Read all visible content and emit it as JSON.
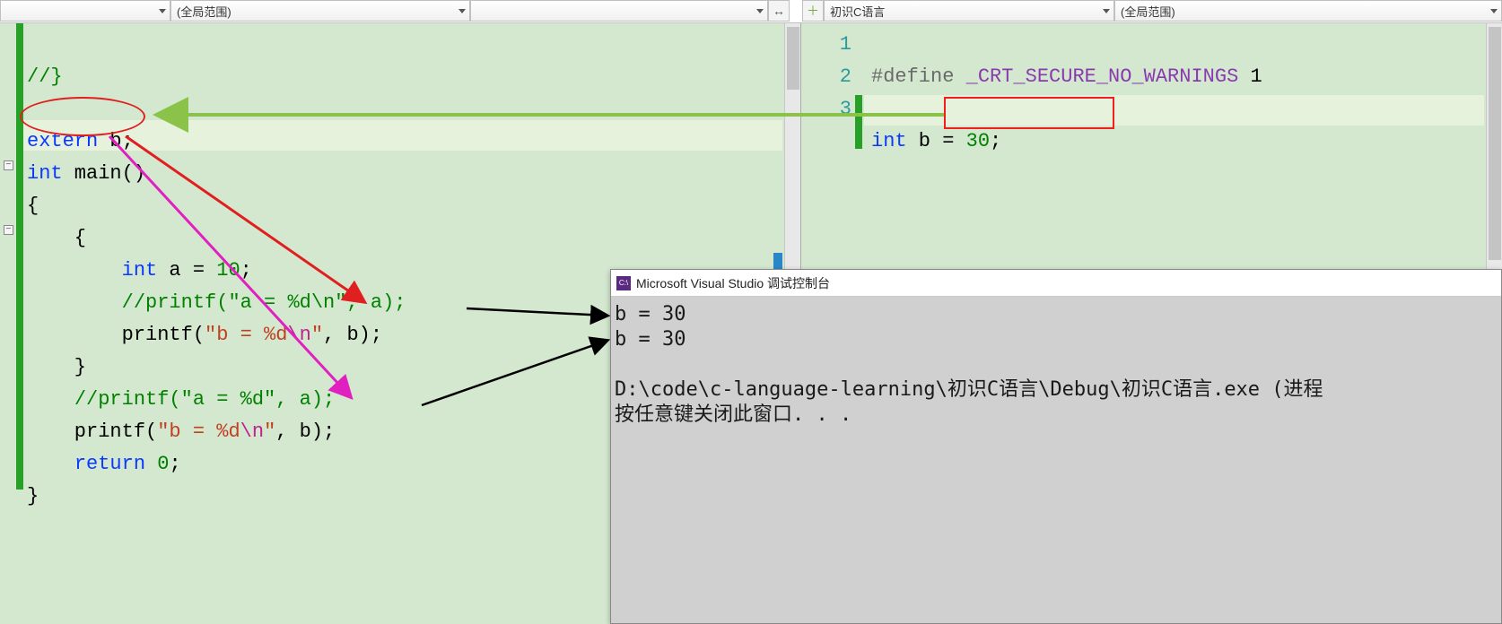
{
  "topbar": {
    "left_dd1": "",
    "left_dd2": "(全局范围)",
    "left_dd3": "",
    "right_dd1": "初识C语言",
    "right_dd2": "(全局范围)"
  },
  "left_code": {
    "l1": "//}",
    "l3a": "extern",
    "l3b": " b;",
    "l4a": "int",
    "l4b": " main()",
    "l5": "{",
    "l6": "    {",
    "l7a": "        ",
    "l7b": "int",
    "l7c": " a = ",
    "l7d": "10",
    "l7e": ";",
    "l8a": "        ",
    "l8b": "//printf(\"a = %d\\n\", a);",
    "l9a": "        printf(",
    "l9b": "\"b = %d",
    "l9c": "\\n",
    "l9d": "\"",
    "l9e": ", b);",
    "l10": "    }",
    "l11a": "    ",
    "l11b": "//printf(\"a = %d\", a);",
    "l12a": "    printf(",
    "l12b": "\"b = %d",
    "l12c": "\\n",
    "l12d": "\"",
    "l12e": ", b);",
    "l13a": "    ",
    "l13b": "return",
    "l13c": " ",
    "l13d": "0",
    "l13e": ";",
    "l14": "}"
  },
  "right_code": {
    "ln1": "1",
    "ln2": "2",
    "ln3": "3",
    "r1a": "#define ",
    "r1b": "_CRT_SECURE_NO_WARNINGS",
    "r1c": " 1",
    "r3a": "int",
    "r3b": " b = ",
    "r3c": "30",
    "r3d": ";"
  },
  "console": {
    "title": "Microsoft Visual Studio 调试控制台",
    "line1": "b = 30",
    "line2": "b = 30",
    "line3": "D:\\code\\c-language-learning\\初识C语言\\Debug\\初识C语言.exe (进程",
    "line4": "按任意键关闭此窗口. . ."
  }
}
